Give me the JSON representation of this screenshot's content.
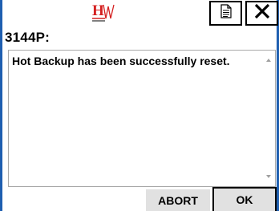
{
  "header": {
    "logo_icon": "hw-logo-icon",
    "doc_icon": "document-icon",
    "close_icon": "close-icon"
  },
  "title": "3144P:",
  "message": "Hot Backup has been successfully reset.",
  "buttons": {
    "abort": "ABORT",
    "ok": "OK"
  },
  "colors": {
    "frame": "#1f5fb0",
    "logo": "#d42020",
    "button_face": "#e1e1e1"
  }
}
